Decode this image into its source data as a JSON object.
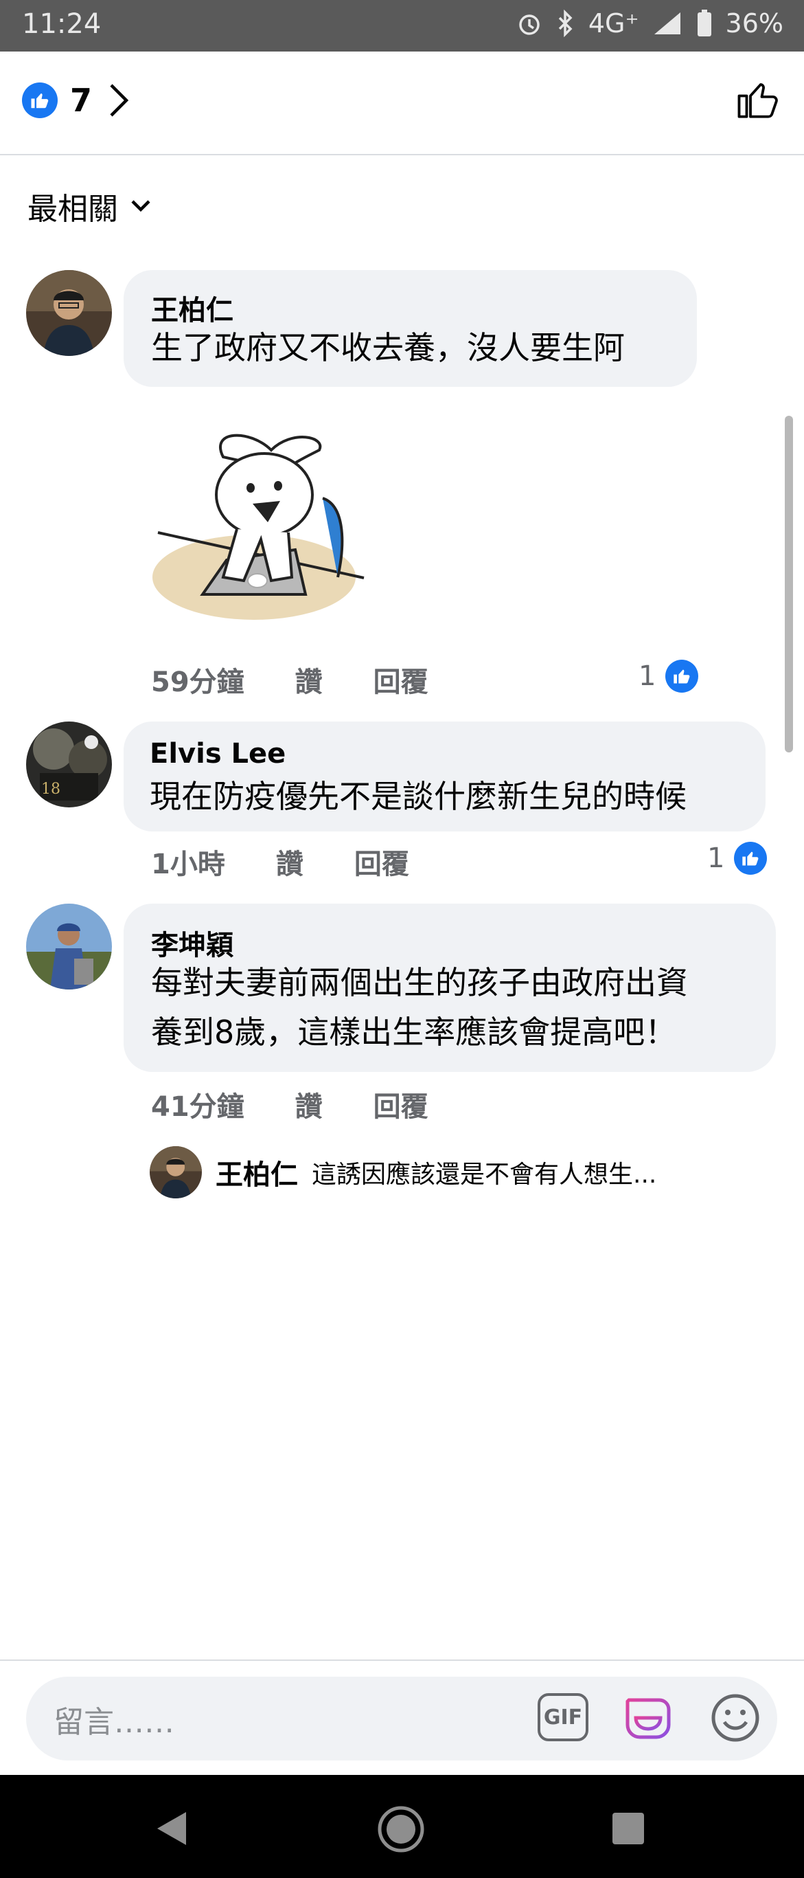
{
  "status_bar": {
    "time": "11:24",
    "network": "4G⁺",
    "battery": "36%"
  },
  "header": {
    "reaction_count": "7"
  },
  "sort": {
    "label": "最相關"
  },
  "comments": [
    {
      "author": "王柏仁",
      "text": "生了政府又不收去養，沒人要生阿",
      "time": "59分鐘",
      "like_label": "讚",
      "reply_label": "回覆",
      "like_count": "1"
    },
    {
      "author": "Elvis Lee",
      "text": "現在防疫優先不是談什麼新生兒的時候",
      "time": "1小時",
      "like_label": "讚",
      "reply_label": "回覆",
      "like_count": "1"
    },
    {
      "author": "李坤穎",
      "text_line1": "每對夫妻前兩個出生的孩子由政府出資",
      "text_line2": "養到8歲，這樣出生率應該會提高吧！",
      "time": "41分鐘",
      "like_label": "讚",
      "reply_label": "回覆",
      "reply_preview": {
        "author": "王柏仁",
        "text": "這誘因應該還是不會有人想生..."
      }
    }
  ],
  "composer": {
    "placeholder": "留言……",
    "gif_label": "GIF"
  },
  "colors": {
    "accent": "#1877f2",
    "bubble": "#f0f2f5",
    "meta": "#65676b"
  }
}
